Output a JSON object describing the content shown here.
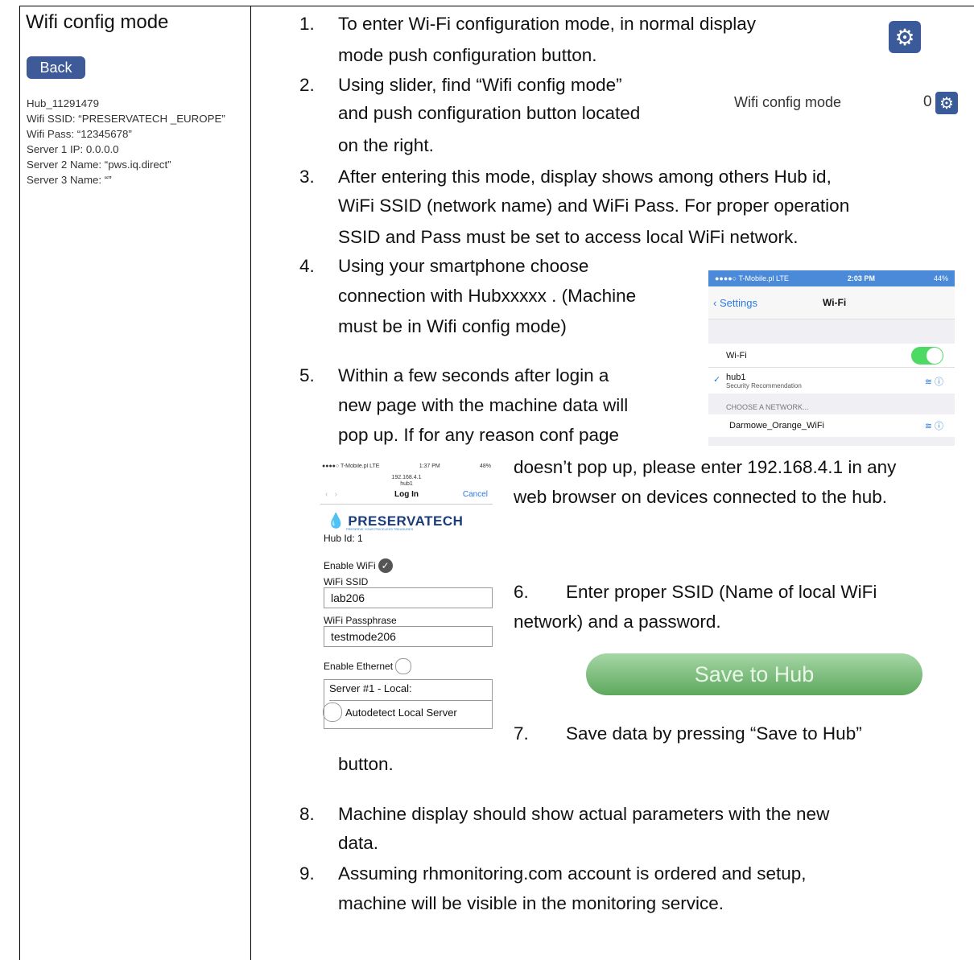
{
  "left": {
    "title": "Wifi config mode",
    "back_label": "Back",
    "info": [
      "Hub_11291479",
      "Wifi SSID: “PRESERVATECH _EUROPE”",
      "Wifi Pass: “12345678”",
      "Server 1 IP: 0.0.0.0",
      "Server 2 Name: “pws.iq.direct”",
      "Server 3 Name: “”"
    ]
  },
  "steps": {
    "s1": {
      "num": "1.",
      "l1": "To enter Wi-Fi configuration mode, in normal display",
      "l2": "mode push configuration button."
    },
    "s2": {
      "num": "2.",
      "l1": "Using slider, find “Wifi config mode”",
      "l2": "and push configuration button located",
      "l3": "on the right."
    },
    "s3": {
      "num": "3.",
      "l1": " After entering this mode, display shows among others Hub id,",
      "l2": "WiFi SSID (network name) and WiFi  Pass. For proper operation",
      "l3": "SSID and Pass must be set to access local WiFi network."
    },
    "s4": {
      "num": "4.",
      "l1": "Using your smartphone choose",
      "l2": "connection with Hubxxxxx . (Machine",
      "l3": "must be in Wifi config mode)"
    },
    "s5": {
      "num": "5.",
      "l1": "Within a few seconds after login a",
      "l2": "new page with the machine data will",
      "l3": "pop up. If for any reason conf page",
      "l4": "doesn’t pop up, please enter 192.168.4.1 in any",
      "l5": "web browser on devices connected to the hub."
    },
    "s6": {
      "num": "6.",
      "l1": "Enter proper SSID (Name of local WiFi",
      "l2": "network) and a password."
    },
    "s7": {
      "num": "7.",
      "l1": "Save data by pressing “Save to Hub”",
      "l2": "button."
    },
    "s8": {
      "num": "8.",
      "l1": "Machine display should show actual parameters with the new",
      "l2": "data."
    },
    "s9": {
      "num": "9.",
      "l1": "Assuming rhmonitoring.com account is ordered and setup,",
      "l2": "machine will be visible in the monitoring service."
    }
  },
  "config_row": {
    "label": "Wifi config mode",
    "value": "0"
  },
  "wifi_screen": {
    "carrier": "●●●●○ T-Mobile.pl  LTE",
    "time": "2:03 PM",
    "battery": "44%",
    "back": "Settings",
    "title": "Wi-Fi",
    "wifi_label": "Wi-Fi",
    "network": "hub1",
    "network_sub": "Security Recommendation",
    "choose": "CHOOSE A NETWORK...",
    "other": "Darmowe_Orange_WiFi"
  },
  "login_screen": {
    "carrier": "●●●●○ T-Mobile.pl  LTE",
    "time": "1:37 PM",
    "battery": "48%",
    "url": "192.168.4.1",
    "sub": "hub1",
    "title": "Log In",
    "cancel": "Cancel",
    "brand": "PRESERVATECH",
    "tagline": "PRESERVE YOUR PRICELESS TREASURES",
    "hub_id": "Hub Id: 1",
    "enable_wifi": "Enable WiFi",
    "ssid_label": "WiFi SSID",
    "ssid_value": "lab206",
    "pass_label": "WiFi Passphrase",
    "pass_value": "testmode206",
    "enable_eth": "Enable Ethernet",
    "server": "Server #1 - Local:",
    "autodetect": "Autodetect Local Server"
  },
  "save_button": "Save to Hub"
}
